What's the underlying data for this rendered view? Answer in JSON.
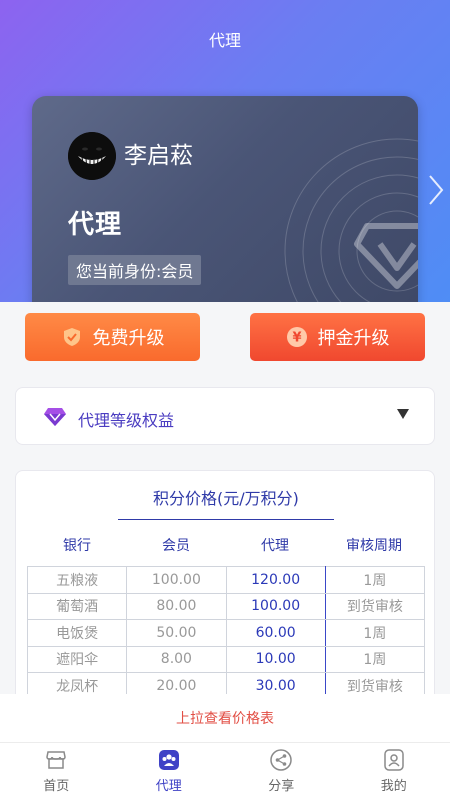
{
  "header": {
    "title": "代理"
  },
  "card": {
    "user_name": "李启菘",
    "level": "代理",
    "identity": "您当前身份:会员"
  },
  "upgrade": {
    "free_label": "免费升级",
    "deposit_label": "押金升级"
  },
  "benefits": {
    "label": "代理等级权益"
  },
  "price_table": {
    "title": "积分价格(元/万积分)",
    "columns": [
      "银行",
      "会员",
      "代理",
      "审核周期"
    ],
    "rows": [
      [
        "五粮液",
        "100.00",
        "120.00",
        "1周"
      ],
      [
        "葡萄酒",
        "80.00",
        "100.00",
        "到货审核"
      ],
      [
        "电饭煲",
        "50.00",
        "60.00",
        "1周"
      ],
      [
        "遮阳伞",
        "8.00",
        "10.00",
        "1周"
      ],
      [
        "龙凤杯",
        "20.00",
        "30.00",
        "到货审核"
      ]
    ]
  },
  "pullup_hint": "上拉查看价格表",
  "tabbar": {
    "items": [
      {
        "label": "首页",
        "icon": "store-icon"
      },
      {
        "label": "代理",
        "icon": "group-icon"
      },
      {
        "label": "分享",
        "icon": "share-icon"
      },
      {
        "label": "我的",
        "icon": "profile-icon"
      }
    ],
    "active_index": 1
  },
  "colors": {
    "accent": "#3f42c6",
    "orange": "#f96a2d",
    "red": "#f0482f",
    "hint_red": "#e24f45"
  }
}
